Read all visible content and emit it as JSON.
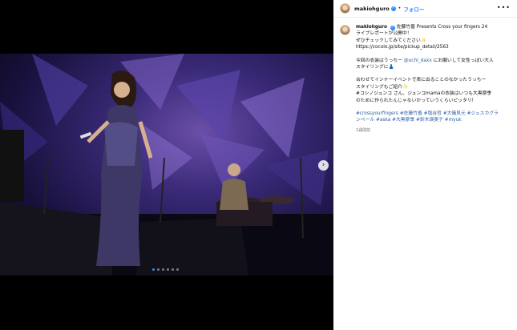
{
  "post": {
    "username": "makiohguro",
    "follow_label": "フォロー",
    "separator": "•",
    "more_icon": "more-horizontal-icon"
  },
  "caption": {
    "username": "makiohguro",
    "lines": [
      {
        "text": "佐藤竹善 Presents Cross your fingers 24"
      },
      {
        "text": "ライブレポートが公開中！"
      },
      {
        "text": "ぜひチェックしてみてください✨"
      },
      {
        "text": "https://cocolo.jp/site/pickup_detail/2563"
      }
    ],
    "para2": [
      {
        "pre": "今回の衣装はうっちー ",
        "mention": "@uchi_daxx",
        "post": " にお願いして女性っぽい大人"
      },
      {
        "pre": "スタイリングに👗",
        "mention": "",
        "post": ""
      }
    ],
    "para3": [
      {
        "text": "合わせてインナーイベントで表に出ることのなかったうっちー"
      },
      {
        "text": "スタイリングもご紹介✨"
      },
      {
        "text": "#コシノジュンコ さん、ジュンコmamaの衣装はいつも大黒摩季"
      },
      {
        "text": "のために作られたんじゃないかっていうくらいピッタリ!"
      }
    ],
    "hashtags": [
      {
        "text": "#crossyourfingers #佐藤竹善 #塩谷哲 #大儀見元 #ジュスカグラ"
      },
      {
        "text": "ンペール #aska #大黒摩季 #鈴木瑛美子 #myuk"
      }
    ],
    "time": "1週間前"
  },
  "media": {
    "next_label": "›",
    "dots": 6,
    "active_dot": 0
  }
}
